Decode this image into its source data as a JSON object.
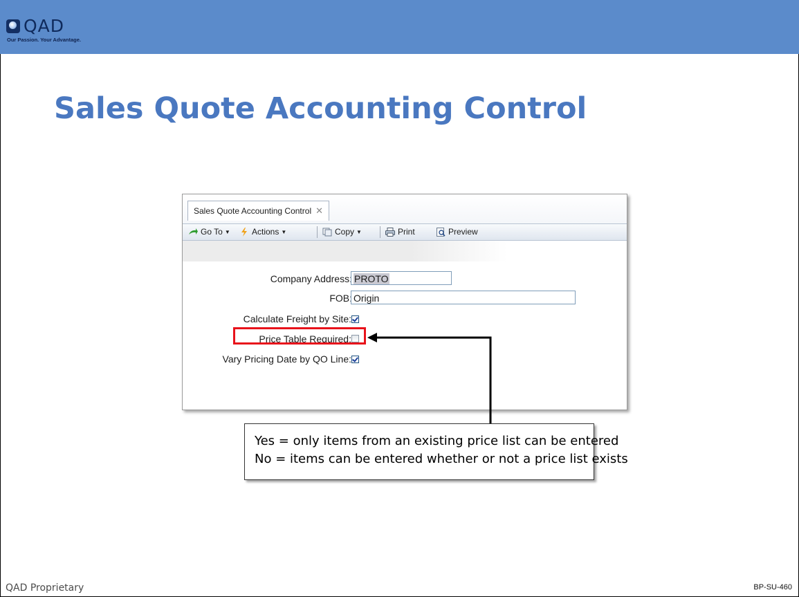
{
  "header": {
    "logo_text": "QAD",
    "tagline": "Our Passion. Your Advantage."
  },
  "slide": {
    "title": "Sales Quote Accounting Control"
  },
  "window": {
    "tab_label": "Sales Quote Accounting Control",
    "toolbar": {
      "goto_label": "Go To",
      "actions_label": "Actions",
      "copy_label": "Copy",
      "print_label": "Print",
      "preview_label": "Preview"
    },
    "form": {
      "company_address_label": "Company Address:",
      "company_address_value": "PROTO",
      "fob_label": "FOB:",
      "fob_value": "Origin",
      "calc_freight_label": "Calculate Freight by Site:",
      "calc_freight_checked": true,
      "price_table_label": "Price Table Required:",
      "price_table_checked": false,
      "vary_pricing_label": "Vary Pricing Date by QO Line:",
      "vary_pricing_checked": true
    }
  },
  "callout": {
    "line1": "Yes = only items from an existing price list can be entered",
    "line2": "No = items can be entered whether or not a price list exists"
  },
  "footer": {
    "left": "QAD Proprietary",
    "right": "BP-SU-460"
  },
  "colors": {
    "header_band": "#5b8bcb",
    "title": "#4a78c0",
    "highlight": "#e8121b"
  }
}
